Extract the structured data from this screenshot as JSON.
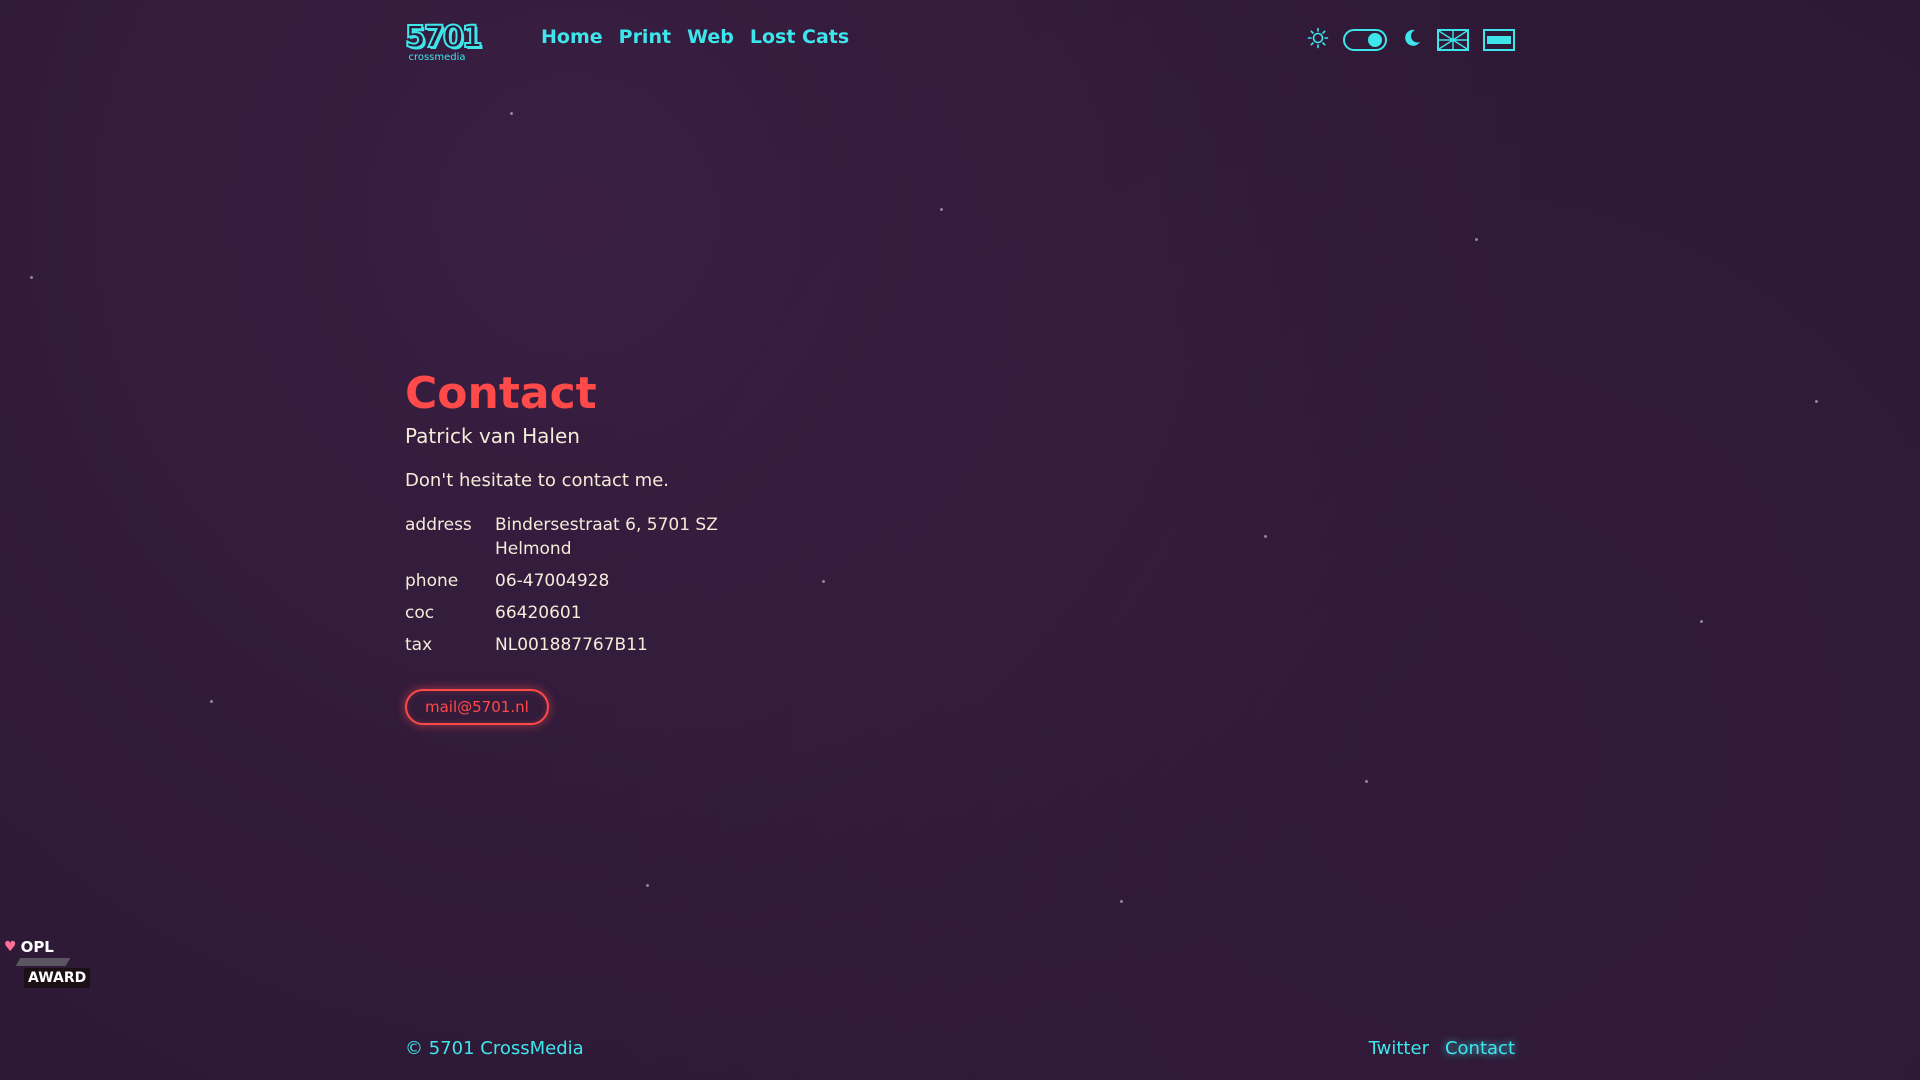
{
  "colors": {
    "background": "#2d1935",
    "accent": "#3ee6ec",
    "heading": "#ff4a4a",
    "text": "#f4ecd8"
  },
  "header": {
    "logo": {
      "main": "5701",
      "sub": "crossmedia"
    },
    "nav": [
      {
        "label": "Home"
      },
      {
        "label": "Print"
      },
      {
        "label": "Web"
      },
      {
        "label": "Lost Cats"
      }
    ],
    "controls": {
      "light_icon": "sun-icon",
      "dark_icon": "moon-icon",
      "theme_toggle_state": "dark",
      "flag_icon": "uk-flag-icon",
      "language_icon": "language-flag-icon"
    }
  },
  "contact": {
    "title": "Contact",
    "name": "Patrick van Halen",
    "intro": "Don't hesitate to contact me.",
    "details": [
      {
        "key": "address",
        "value_line1": "Bindersestraat 6, 5701 SZ",
        "value_line2": "Helmond"
      },
      {
        "key": "phone",
        "value_line1": "06-47004928"
      },
      {
        "key": "coc",
        "value_line1": "66420601"
      },
      {
        "key": "tax",
        "value_line1": "NL001887767B11"
      }
    ],
    "mail_button": "mail@5701.nl"
  },
  "award": {
    "line1": "OPL",
    "line2": "AWARD",
    "icon": "heart-icon"
  },
  "footer": {
    "copyright": "© 5701 CrossMedia",
    "links": [
      {
        "label": "Twitter"
      },
      {
        "label": "Contact"
      }
    ]
  }
}
